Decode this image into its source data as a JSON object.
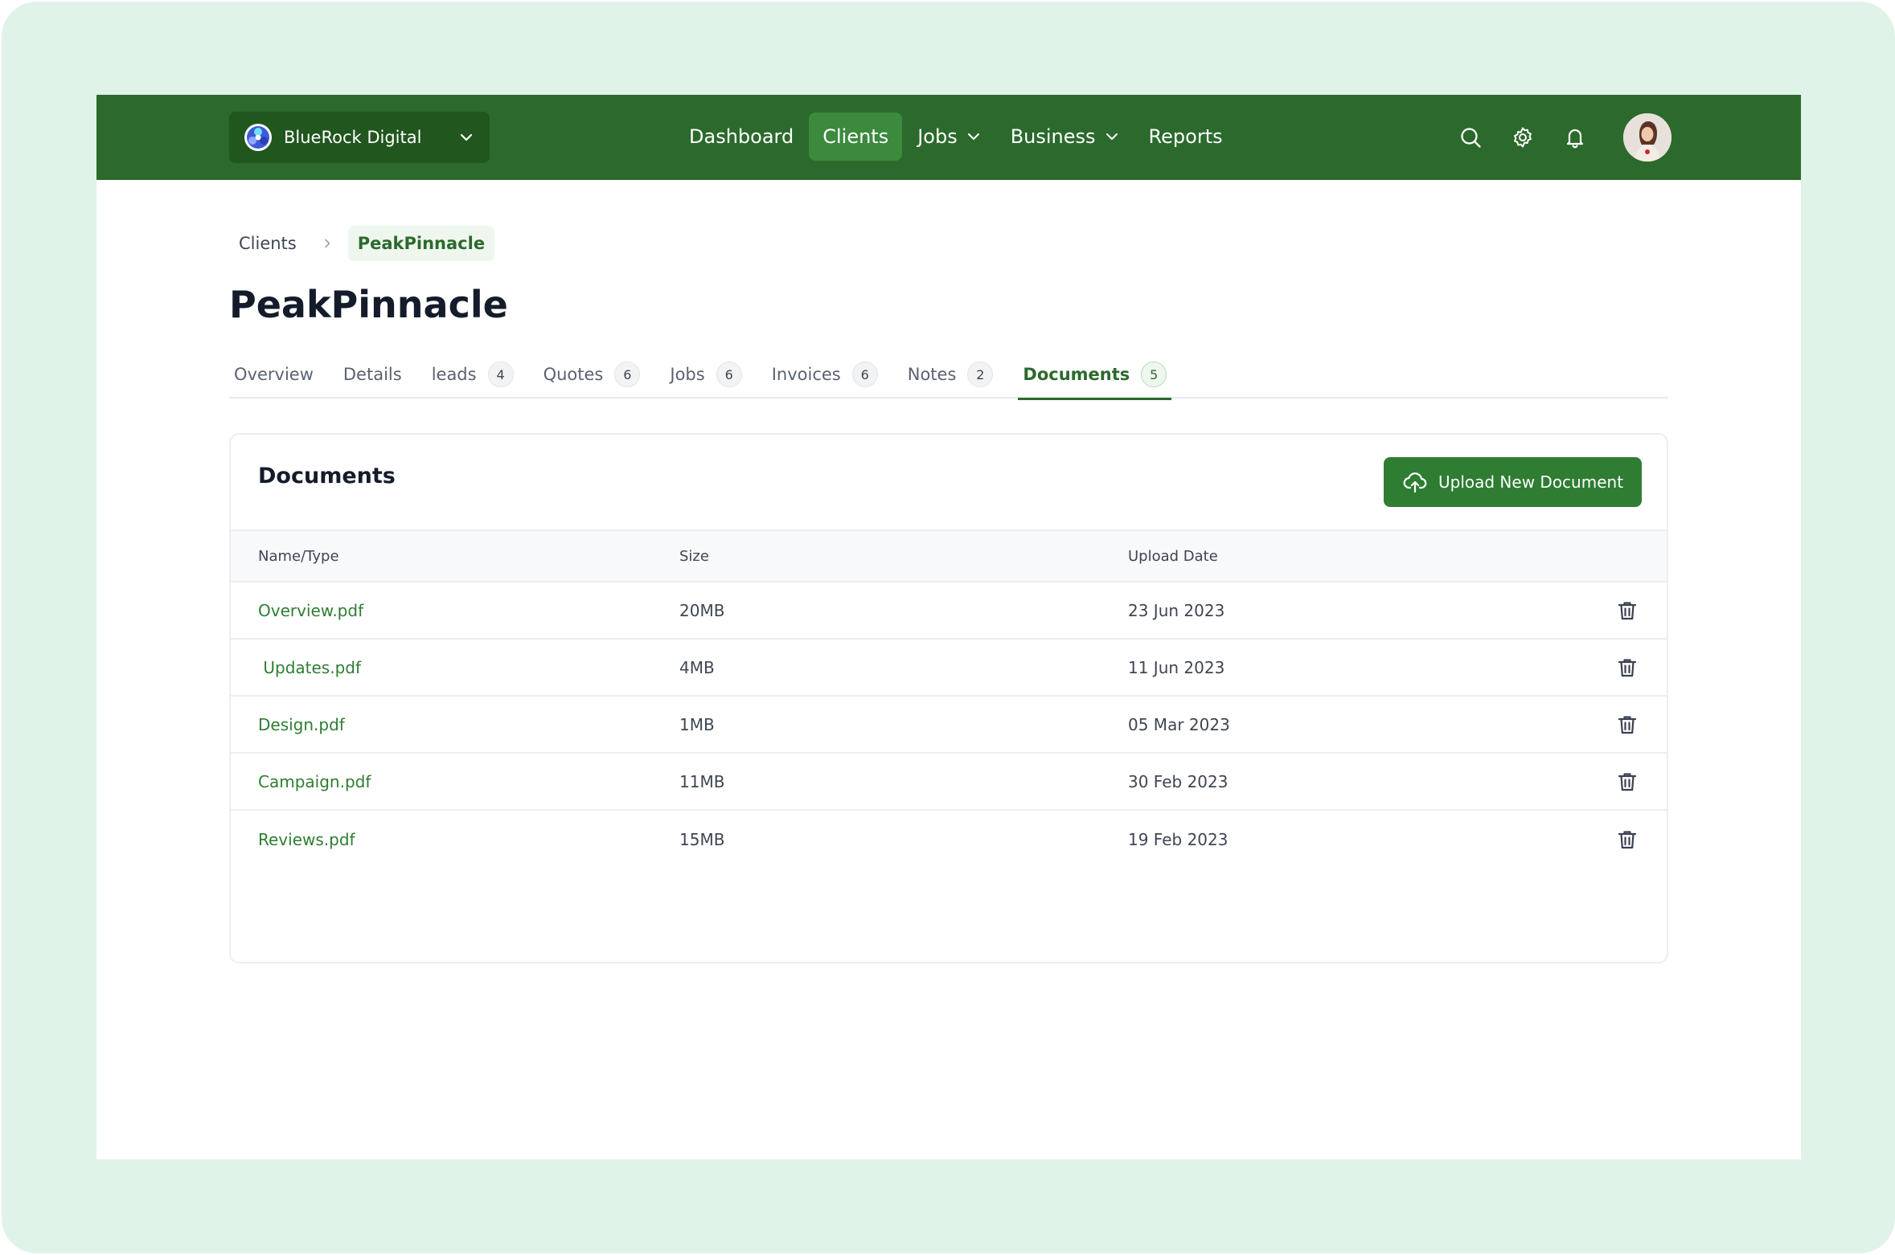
{
  "org": {
    "name": "BlueRock Digital"
  },
  "nav": {
    "items": [
      {
        "label": "Dashboard"
      },
      {
        "label": "Clients"
      },
      {
        "label": "Jobs"
      },
      {
        "label": "Business"
      },
      {
        "label": "Reports"
      }
    ],
    "active": "Clients"
  },
  "breadcrumb": {
    "parent": "Clients",
    "current": "PeakPinnacle"
  },
  "page": {
    "title": "PeakPinnacle"
  },
  "tabs": [
    {
      "label": "Overview"
    },
    {
      "label": "Details"
    },
    {
      "label": "leads",
      "count": "4"
    },
    {
      "label": "Quotes",
      "count": "6"
    },
    {
      "label": "Jobs",
      "count": "6"
    },
    {
      "label": "Invoices",
      "count": "6"
    },
    {
      "label": "Notes",
      "count": "2"
    },
    {
      "label": "Documents",
      "count": "5"
    }
  ],
  "active_tab": "Documents",
  "documents": {
    "title": "Documents",
    "upload_label": "Upload New Document",
    "columns": [
      "Name/Type",
      "Size",
      "Upload Date"
    ],
    "rows": [
      {
        "name": "Overview.pdf",
        "size": "20MB",
        "date": "23 Jun 2023"
      },
      {
        "name": " Updates.pdf",
        "size": "4MB",
        "date": "11 Jun 2023"
      },
      {
        "name": "Design.pdf",
        "size": "1MB",
        "date": "05 Mar 2023"
      },
      {
        "name": "Campaign.pdf",
        "size": "11MB",
        "date": "30 Feb 2023"
      },
      {
        "name": "Reviews.pdf",
        "size": "15MB",
        "date": "19 Feb 2023"
      }
    ]
  },
  "colors": {
    "brand": "#2b6a2c",
    "brand_dark": "#21561f",
    "nav_active": "#3b8a3d",
    "accent": "#2e7d32",
    "backdrop": "#dff3e9"
  },
  "icons": [
    "org-logo-icon",
    "chevron-down-icon",
    "search-icon",
    "gear-icon",
    "bell-icon",
    "chevron-right-icon",
    "upload-cloud-icon",
    "trash-icon"
  ]
}
